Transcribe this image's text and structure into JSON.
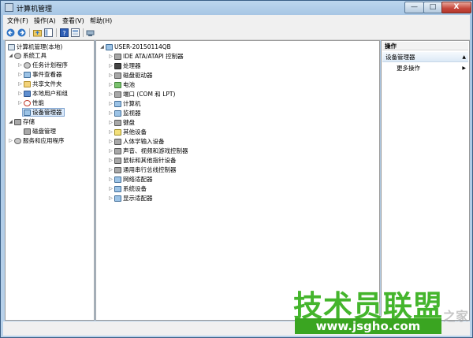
{
  "window": {
    "title": "计算机管理",
    "min_label": "—",
    "max_label": "□",
    "close_label": "X"
  },
  "menu": [
    {
      "label": "文件(F)"
    },
    {
      "label": "操作(A)"
    },
    {
      "label": "查看(V)"
    },
    {
      "label": "帮助(H)"
    }
  ],
  "toolbar": {
    "buttons": [
      "back-icon",
      "forward-icon",
      "up-folder-icon",
      "console-tree-icon",
      "help-icon",
      "view-icon",
      "device-icon"
    ]
  },
  "left_tree": [
    {
      "label": "计算机管理(本地)",
      "expander": "",
      "icon": "computer-management-icon",
      "level": 0
    },
    {
      "label": "系统工具",
      "expander": "◢",
      "icon": "tools-icon",
      "level": 1
    },
    {
      "label": "任务计划程序",
      "expander": "▷",
      "icon": "clock-icon",
      "level": 2
    },
    {
      "label": "事件查看器",
      "expander": "▷",
      "icon": "event-viewer-icon",
      "level": 2
    },
    {
      "label": "共享文件夹",
      "expander": "▷",
      "icon": "shared-folder-icon",
      "level": 2
    },
    {
      "label": "本地用户和组",
      "expander": "▷",
      "icon": "users-icon",
      "level": 2
    },
    {
      "label": "性能",
      "expander": "▷",
      "icon": "performance-icon",
      "level": 2
    },
    {
      "label": "设备管理器",
      "expander": "",
      "icon": "device-manager-icon",
      "level": 2,
      "selected": true
    },
    {
      "label": "存储",
      "expander": "◢",
      "icon": "storage-icon",
      "level": 1
    },
    {
      "label": "磁盘管理",
      "expander": "",
      "icon": "disk-management-icon",
      "level": 2
    },
    {
      "label": "服务和应用程序",
      "expander": "▷",
      "icon": "services-icon",
      "level": 1
    }
  ],
  "device_tree": {
    "root": {
      "label": "USER-20150114QB",
      "expander": "◢",
      "icon": "computer-icon"
    },
    "items": [
      {
        "label": "IDE ATA/ATAPI 控制器",
        "icon": "ide-controller-icon"
      },
      {
        "label": "处理器",
        "icon": "processor-icon"
      },
      {
        "label": "磁盘驱动器",
        "icon": "disk-drive-icon"
      },
      {
        "label": "电池",
        "icon": "battery-icon"
      },
      {
        "label": "端口 (COM 和 LPT)",
        "icon": "port-icon"
      },
      {
        "label": "计算机",
        "icon": "computer-icon"
      },
      {
        "label": "监视器",
        "icon": "monitor-icon"
      },
      {
        "label": "键盘",
        "icon": "keyboard-icon"
      },
      {
        "label": "其他设备",
        "icon": "other-devices-icon"
      },
      {
        "label": "人体学输入设备",
        "icon": "hid-icon"
      },
      {
        "label": "声音、视频和游戏控制器",
        "icon": "sound-icon"
      },
      {
        "label": "鼠标和其他指针设备",
        "icon": "mouse-icon"
      },
      {
        "label": "通用串行总线控制器",
        "icon": "usb-icon"
      },
      {
        "label": "网络适配器",
        "icon": "network-adapter-icon"
      },
      {
        "label": "系统设备",
        "icon": "system-devices-icon"
      },
      {
        "label": "显示适配器",
        "icon": "display-adapter-icon"
      }
    ],
    "expander": "▷"
  },
  "actions": {
    "header": "操作",
    "section": "设备管理器",
    "section_arrow": "▲",
    "more": "更多操作",
    "more_arrow": "▶"
  },
  "watermark": {
    "text": "技术员联盟",
    "url": "www.jsgho.com",
    "fade": "之家"
  }
}
